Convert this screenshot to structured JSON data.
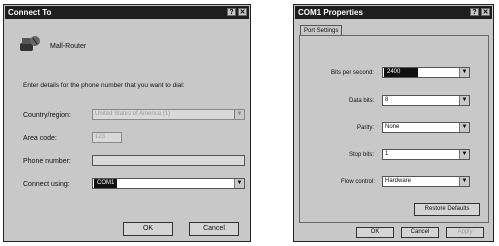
{
  "connect_dialog": {
    "title": "Connect To",
    "connection_name": "Mall-Router",
    "instruction": "Enter details for the phone number that you want to dial:",
    "country_label": "Country/region:",
    "country_value": "United States of America (1)",
    "area_code_label": "Area code:",
    "area_code_value": "123",
    "phone_label": "Phone number:",
    "phone_value": "",
    "connect_using_label": "Connect using:",
    "connect_using_value": "COM1",
    "ok_label": "OK",
    "cancel_label": "Cancel"
  },
  "com_dialog": {
    "title": "COM1 Properties",
    "tab_label": "Port Settings",
    "bits_label": "Bits per second:",
    "bits_value": "2400",
    "data_bits_label": "Data bits:",
    "data_bits_value": "8",
    "parity_label": "Parity:",
    "parity_value": "None",
    "stop_bits_label": "Stop bits:",
    "stop_bits_value": "1",
    "flow_label": "Flow control:",
    "flow_value": "Hardware",
    "restore_label": "Restore Defaults",
    "ok_label": "OK",
    "cancel_label": "Cancel",
    "apply_label": "Apply"
  }
}
